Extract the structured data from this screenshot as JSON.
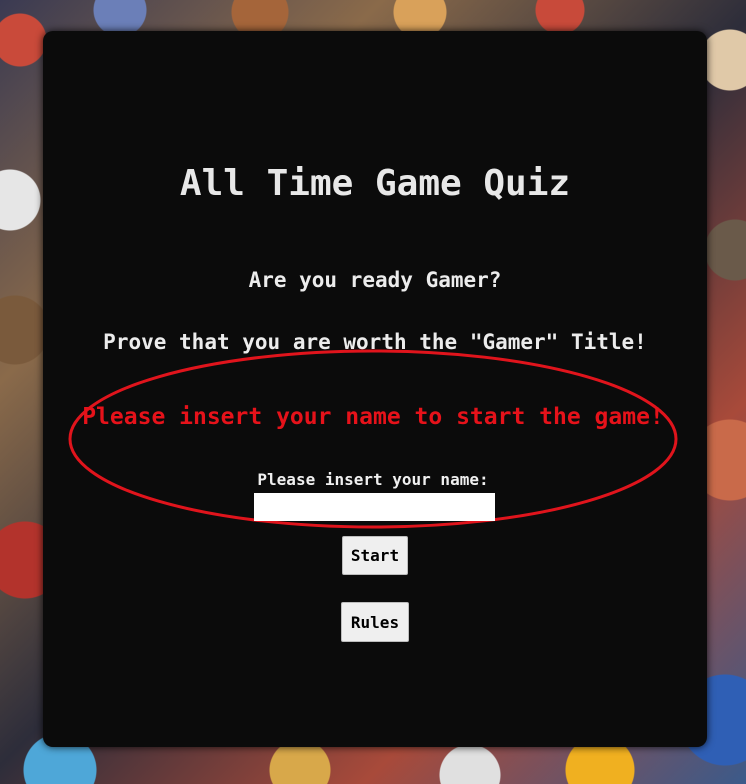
{
  "quiz": {
    "title": "All Time Game Quiz",
    "intro_line_1": "Are you ready Gamer?",
    "intro_line_2": "Prove that you are worth the \"Gamer\" Title!",
    "warning": "Please insert your name to start the game!",
    "name_label": "Please insert your name:",
    "name_value": "",
    "start_label": "Start",
    "rules_label": "Rules"
  },
  "colors": {
    "card_background": "#0b0b0b",
    "warning_text": "#e6121a",
    "annotation_ellipse": "#e0141c",
    "button_background": "#efefef"
  }
}
